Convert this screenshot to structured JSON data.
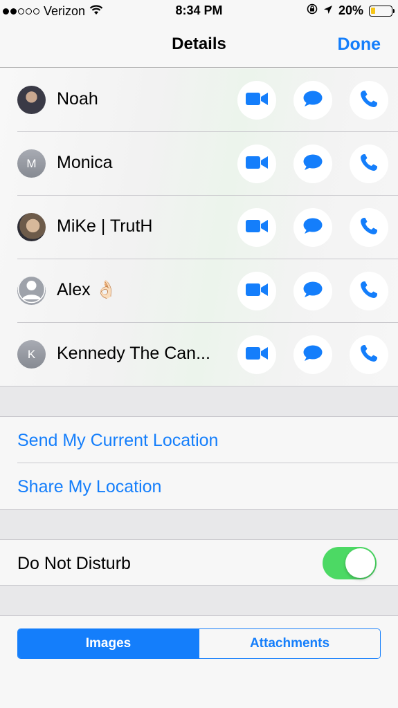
{
  "status_bar": {
    "carrier": "Verizon",
    "time": "8:34 PM",
    "battery": "20%",
    "battery_level": 0.2,
    "signal_bars": 2,
    "signal_total": 5,
    "icons": [
      "wifi-icon",
      "rotation-lock-icon",
      "location-arrow-icon",
      "battery-icon"
    ]
  },
  "nav": {
    "title": "Details",
    "done": "Done"
  },
  "contacts": [
    {
      "name": "Noah",
      "avatar": "photo",
      "initial": ""
    },
    {
      "name": "Monica",
      "avatar": "initial",
      "initial": "M"
    },
    {
      "name": "MiKe | TrutH",
      "avatar": "photo",
      "initial": ""
    },
    {
      "name": "Alex 👌🏻",
      "avatar": "silhouette",
      "initial": ""
    },
    {
      "name": "Kennedy The Can...",
      "avatar": "initial",
      "initial": "K"
    }
  ],
  "actions": [
    "video-icon",
    "message-icon",
    "phone-icon"
  ],
  "location": {
    "send_current": "Send My Current Location",
    "share": "Share My Location"
  },
  "dnd": {
    "label": "Do Not Disturb",
    "enabled": true
  },
  "segments": {
    "images": "Images",
    "attachments": "Attachments",
    "selected": "Images"
  },
  "colors": {
    "accent": "#147efb",
    "toggle_on": "#4cd964",
    "battery": "#f5c518"
  }
}
